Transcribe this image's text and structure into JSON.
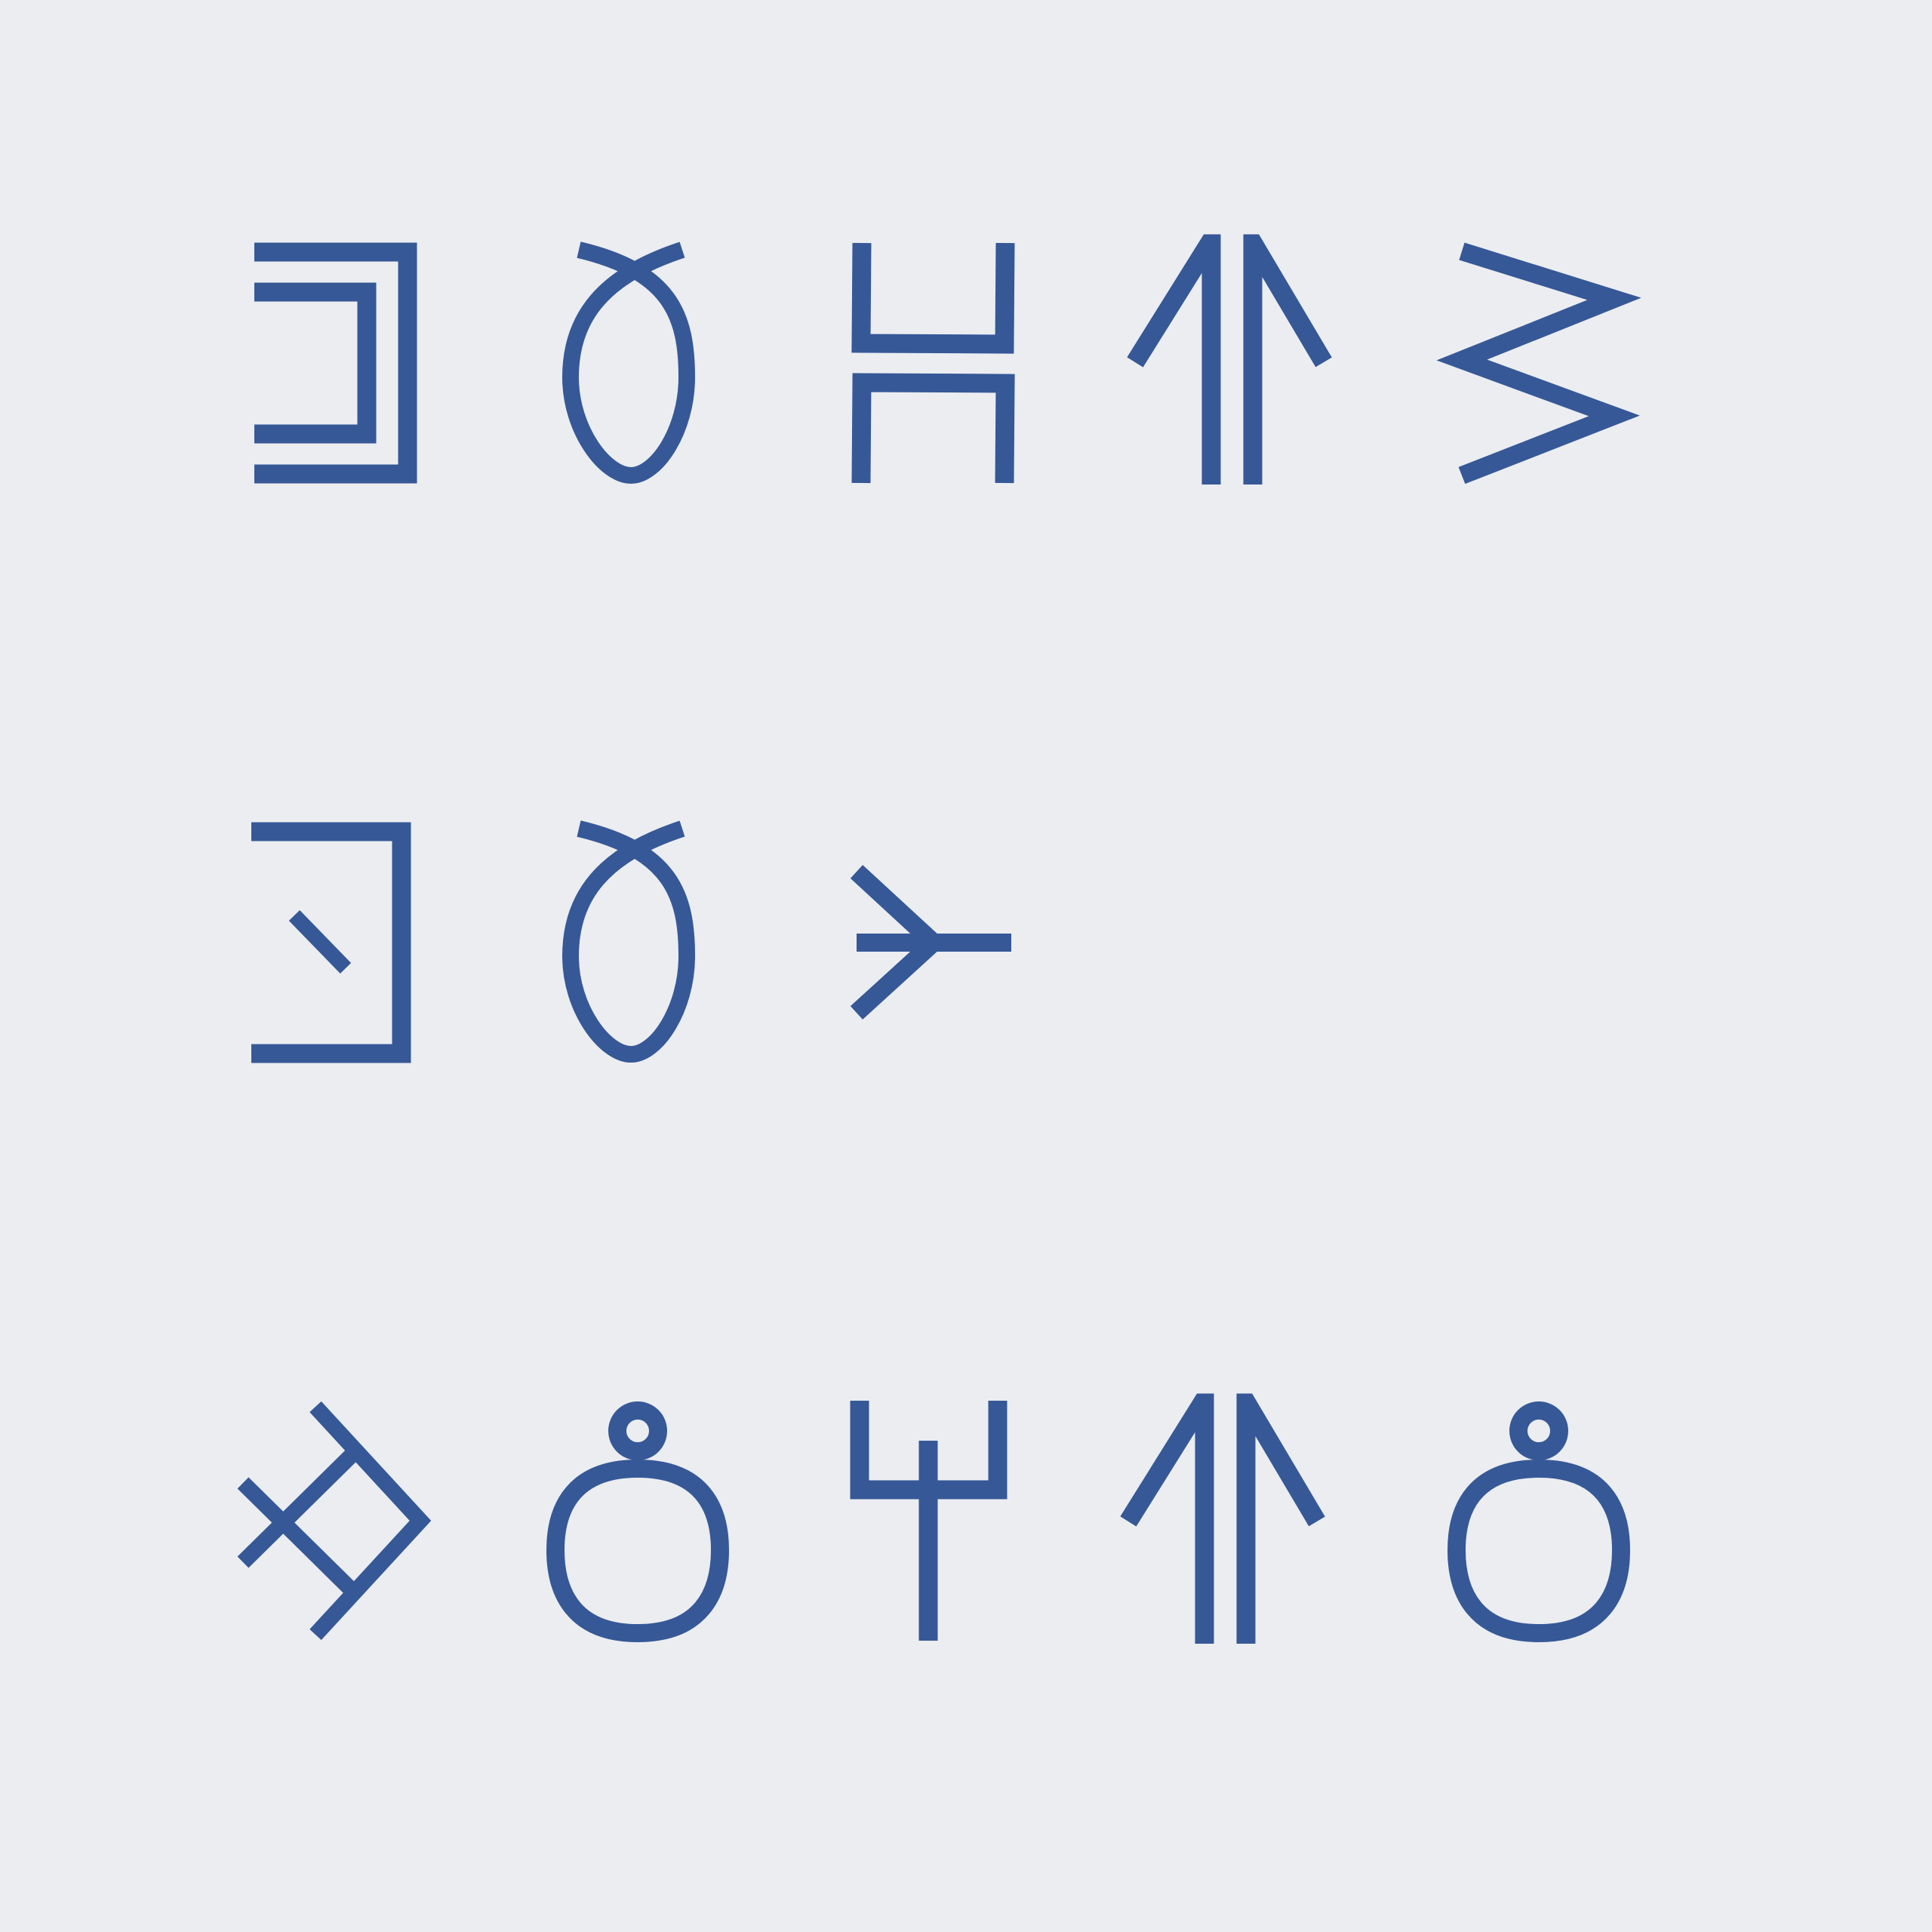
{
  "colors": {
    "background": "#ebedf1",
    "glyph": "#365897"
  },
  "rows": [
    {
      "name": "row-1",
      "glyphs": [
        "bracket-double-icon",
        "loop-fish-icon",
        "offset-brackets-icon",
        "double-arrow-up-icon",
        "zigzag-icon"
      ]
    },
    {
      "name": "row-2",
      "glyphs": [
        "bracket-tick-icon",
        "loop-fish-icon",
        "arrow-fork-icon"
      ]
    },
    {
      "name": "row-3",
      "glyphs": [
        "crossed-diamond-icon",
        "ring-bulb-icon",
        "trident-icon",
        "double-arrow-up-icon",
        "ring-bulb-icon"
      ]
    }
  ]
}
